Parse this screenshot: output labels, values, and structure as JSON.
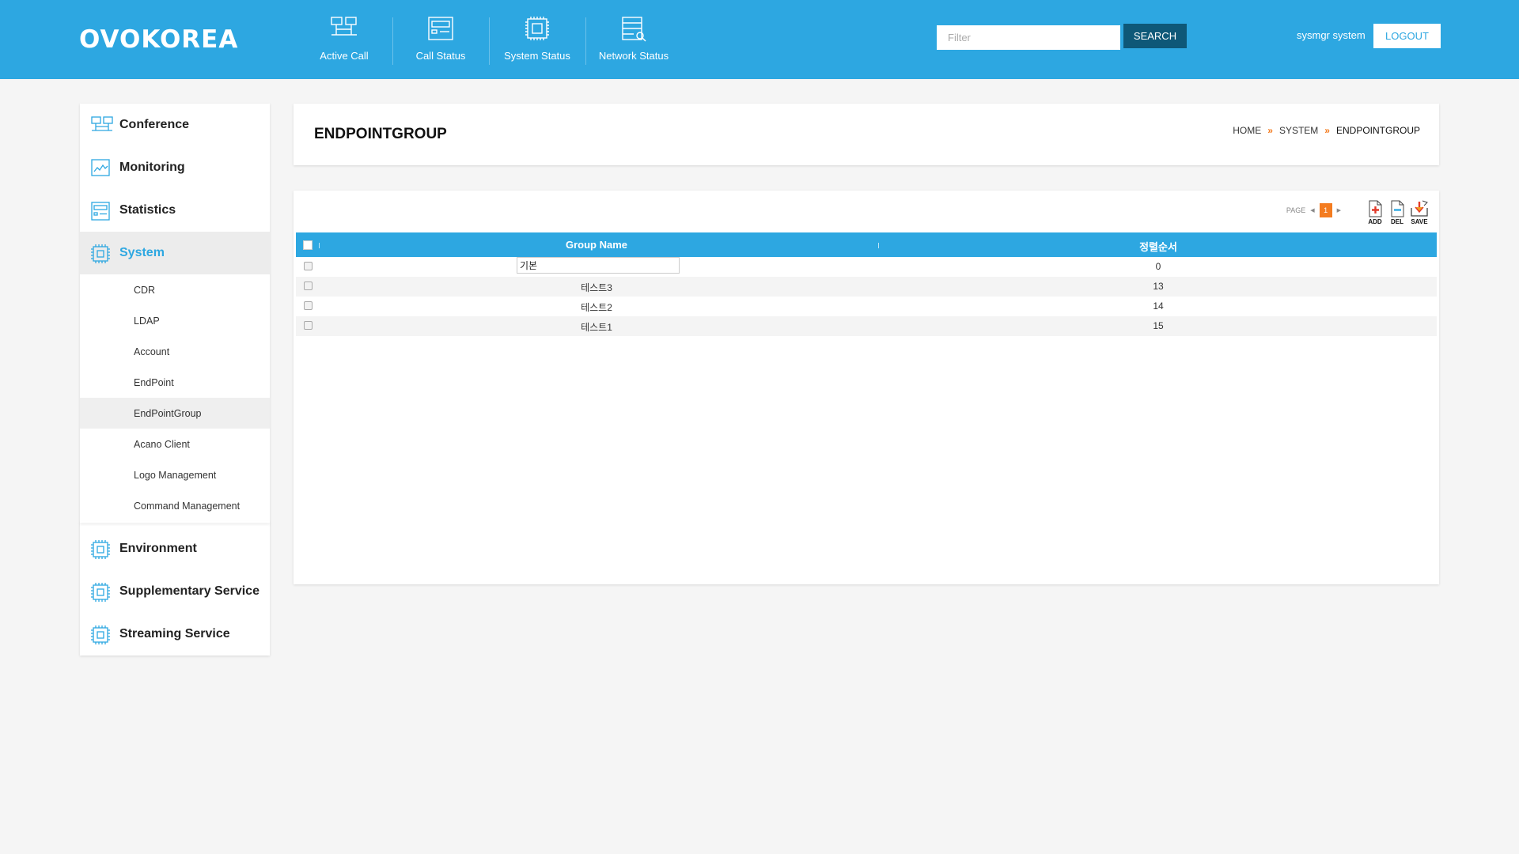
{
  "header": {
    "logo": "OVOKOREA",
    "nav": [
      {
        "label": "Active Call",
        "icon": "active-call-icon"
      },
      {
        "label": "Call Status",
        "icon": "call-status-icon"
      },
      {
        "label": "System Status",
        "icon": "system-status-icon"
      },
      {
        "label": "Network Status",
        "icon": "network-status-icon"
      }
    ],
    "filter_placeholder": "Filter",
    "search_label": "SEARCH",
    "user": "sysmgr system",
    "logout_label": "LOGOUT"
  },
  "sidebar": {
    "items": [
      {
        "label": "Conference",
        "icon": "conference-icon"
      },
      {
        "label": "Monitoring",
        "icon": "monitoring-icon"
      },
      {
        "label": "Statistics",
        "icon": "statistics-icon"
      },
      {
        "label": "System",
        "icon": "system-icon",
        "active": true
      }
    ],
    "sub_items": [
      "CDR",
      "LDAP",
      "Account",
      "EndPoint",
      "EndPointGroup",
      "Acano Client",
      "Logo Management",
      "Command Management"
    ],
    "active_sub": "EndPointGroup",
    "lower_items": [
      {
        "label": "Environment",
        "icon": "environment-icon"
      },
      {
        "label": "Supplementary Service",
        "icon": "supplementary-service-icon"
      },
      {
        "label": "Streaming Service",
        "icon": "streaming-service-icon"
      }
    ]
  },
  "page": {
    "title": "ENDPOINTGROUP",
    "breadcrumb": [
      "HOME",
      "SYSTEM",
      "ENDPOINTGROUP"
    ]
  },
  "toolbar": {
    "page_label": "PAGE",
    "page_prev": "◀",
    "current_page": "1",
    "page_next": "▶",
    "add_label": "ADD",
    "del_label": "DEL",
    "save_label": "SAVE"
  },
  "grid": {
    "columns": [
      "Group Name",
      "정렬순서"
    ],
    "rows": [
      {
        "name": "기본",
        "order": "0",
        "editing": true
      },
      {
        "name": "테스트3",
        "order": "13"
      },
      {
        "name": "테스트2",
        "order": "14"
      },
      {
        "name": "테스트1",
        "order": "15"
      }
    ]
  },
  "colors": {
    "header_bg": "#2da7e1",
    "search_btn": "#0e5878",
    "accent_orange": "#f47c20"
  }
}
